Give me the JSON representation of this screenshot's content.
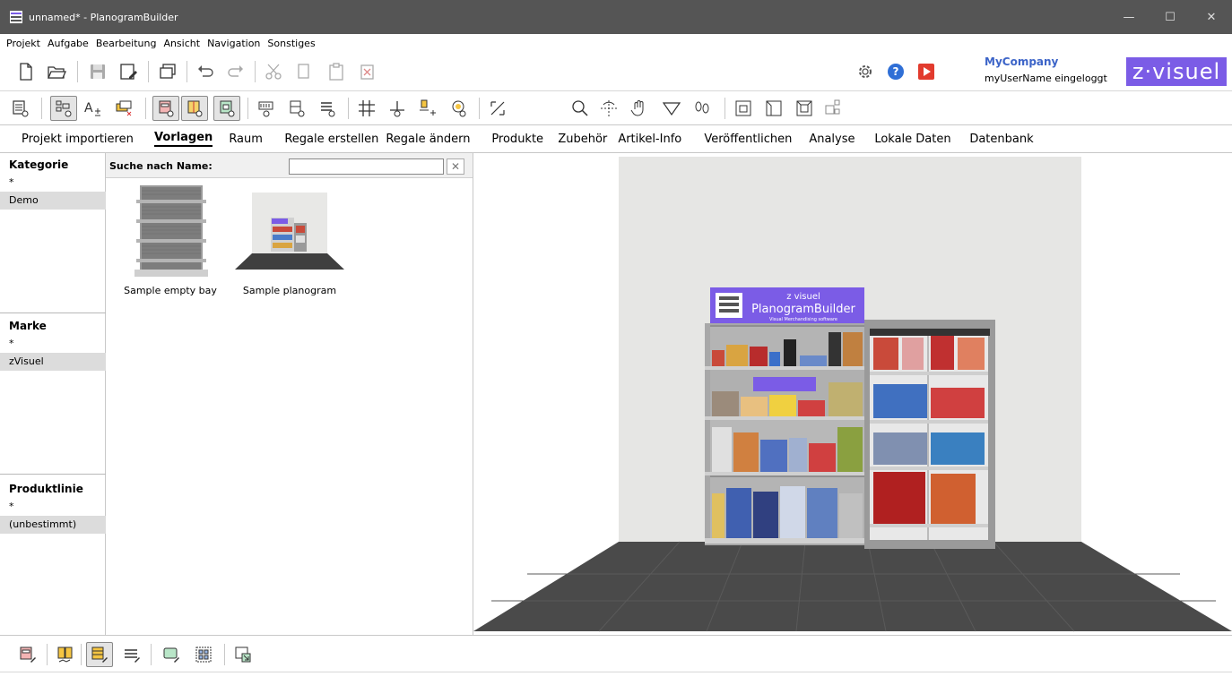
{
  "window": {
    "title": "unnamed* - PlanogramBuilder",
    "controls": [
      "—",
      "☐",
      "✕"
    ]
  },
  "menu": [
    "Projekt",
    "Aufgabe",
    "Bearbeitung",
    "Ansicht",
    "Navigation",
    "Sonstiges"
  ],
  "toolbar_main": {
    "icons": [
      "new-file-icon",
      "open-folder-icon",
      "save-icon",
      "save-as-icon",
      "copy-window-icon",
      "undo-icon",
      "redo-icon",
      "cut-icon",
      "copy-icon",
      "paste-icon",
      "delete-icon"
    ],
    "right_icons": [
      "settings-icon",
      "help-icon",
      "video-icon"
    ]
  },
  "account": {
    "company": "MyCompany",
    "user_status": "myUserName eingeloggt",
    "logo_text": "z·visuel"
  },
  "toolbar_view": {
    "icons": [
      "view-list-icon",
      "view-tree-icon",
      "text-size-icon",
      "label-highlight-icon",
      "shelf-view-icon",
      "shelf-side-view-icon",
      "shelf-front-view-icon",
      "shelf-eye-icon",
      "product-eye-icon",
      "facing-eye-icon",
      "grid-icon",
      "baseline-icon",
      "tag-plus-icon",
      "lighting-icon",
      "expand-icon",
      "zoom-icon",
      "rotate-icon",
      "pan-icon",
      "perspective-icon",
      "footprints-icon",
      "front-camera-icon",
      "side-camera-icon",
      "top-camera-icon",
      "layout-camera-icon"
    ]
  },
  "tabs": [
    {
      "label": "Projekt importieren",
      "active": false
    },
    {
      "label": "Vorlagen",
      "active": true
    },
    {
      "label": "Raum",
      "active": false
    },
    {
      "label": "Regale erstellen",
      "active": false
    },
    {
      "label": "Regale ändern",
      "active": false
    },
    {
      "label": "Produkte",
      "active": false
    },
    {
      "label": "Zubehör",
      "active": false
    },
    {
      "label": "Artikel-Info",
      "active": false
    },
    {
      "label": "Veröffentlichen",
      "active": false
    },
    {
      "label": "Analyse",
      "active": false
    },
    {
      "label": "Lokale Daten",
      "active": false
    },
    {
      "label": "Datenbank",
      "active": false
    }
  ],
  "filters": {
    "kategorie": {
      "title": "Kategorie",
      "all": "*",
      "selected": "Demo"
    },
    "marke": {
      "title": "Marke",
      "all": "*",
      "selected": "zVisuel"
    },
    "produktlinie": {
      "title": "Produktlinie",
      "all": "*",
      "selected": "(unbestimmt)"
    }
  },
  "templates": {
    "search_label": "Suche nach Name:",
    "search_value": "",
    "clear_symbol": "✕",
    "items": [
      {
        "name": "Sample empty bay"
      },
      {
        "name": "Sample planogram"
      }
    ]
  },
  "scene": {
    "header_brand": "z visuel",
    "header_product": "PlanogramBuilder",
    "header_tagline": "Visual Merchandising software",
    "wall_color": "#e6e6e4",
    "floor_color": "#4a4a4a",
    "accent_color": "#7b5ce6"
  },
  "toolbar_bottom": {
    "icons": [
      "edit-shelf-icon",
      "edit-bays-icon",
      "edit-facings-icon",
      "edit-rows-icon",
      "edit-label-icon",
      "edit-grid-icon",
      "export-icon"
    ]
  }
}
